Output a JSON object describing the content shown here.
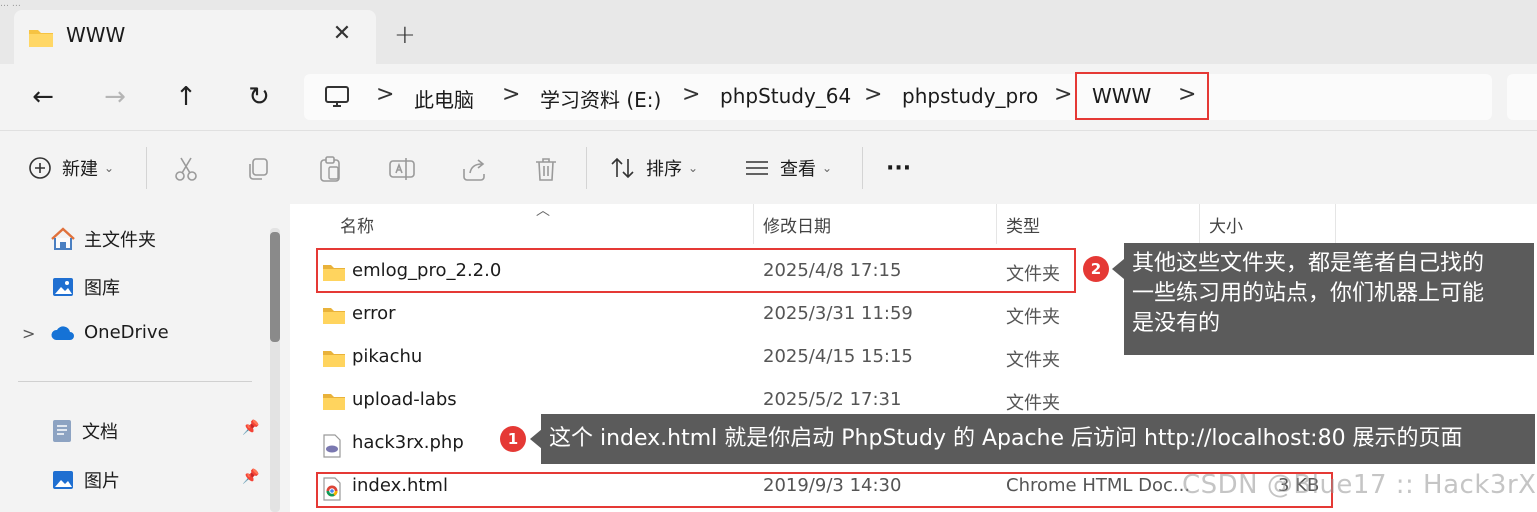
{
  "top_clipped_text": "… …",
  "tab": {
    "title": "WWW",
    "close_glyph": "✕",
    "new_tab_glyph": "+"
  },
  "nav": {
    "back": "←",
    "forward": "→",
    "up": "↑",
    "refresh": "↻"
  },
  "breadcrumb": [
    {
      "label": "此电脑"
    },
    {
      "label": "学习资料 (E:)"
    },
    {
      "label": "phpStudy_64"
    },
    {
      "label": "phpstudy_pro"
    },
    {
      "label": "WWW"
    }
  ],
  "breadcrumb_chevron": ">",
  "toolbar": {
    "new_label": "新建",
    "sort_label": "排序",
    "view_label": "查看",
    "more_label": "···",
    "chevron": "⌄"
  },
  "sidebar": {
    "items": [
      {
        "label": "主文件夹",
        "icon": "home-icon"
      },
      {
        "label": "图库",
        "icon": "gallery-icon"
      },
      {
        "label": "OneDrive",
        "icon": "cloud-icon",
        "expander": ">"
      },
      {
        "label": "文档",
        "icon": "document-icon",
        "pinned": true
      },
      {
        "label": "图片",
        "icon": "pictures-icon",
        "pinned": true
      }
    ]
  },
  "columns": {
    "name": "名称",
    "modified": "修改日期",
    "type": "类型",
    "size": "大小"
  },
  "files": [
    {
      "name": "emlog_pro_2.2.0",
      "modified": "2025/4/8 17:15",
      "type": "文件夹",
      "size": "",
      "icon": "folder-icon"
    },
    {
      "name": "error",
      "modified": "2025/3/31 11:59",
      "type": "文件夹",
      "size": "",
      "icon": "folder-icon"
    },
    {
      "name": "pikachu",
      "modified": "2025/4/15 15:15",
      "type": "文件夹",
      "size": "",
      "icon": "folder-icon"
    },
    {
      "name": "upload-labs",
      "modified": "2025/5/2 17:31",
      "type": "文件夹",
      "size": "",
      "icon": "folder-icon"
    },
    {
      "name": "hack3rx.php",
      "modified": "",
      "type": "",
      "size": "",
      "icon": "php-file-icon"
    },
    {
      "name": "index.html",
      "modified": "2019/9/3 14:30",
      "type": "Chrome HTML Doc...",
      "size": "3 KB",
      "icon": "chrome-file-icon"
    }
  ],
  "callouts": [
    {
      "number": "1",
      "text": "这个 index.html 就是你启动 PhpStudy 的 Apache 后访问 http://localhost:80 展示的页面"
    },
    {
      "number": "2",
      "lines": [
        "其他这些文件夹，都是笔者自己找的",
        "一些练习用的站点，你们机器上可能",
        "是没有的"
      ]
    }
  ],
  "watermark": "CSDN @Blue17 :: Hack3rX",
  "colors": {
    "highlight": "#e53935",
    "tooltip_bg": "#5b5b5b",
    "folder": "#f6c342"
  }
}
